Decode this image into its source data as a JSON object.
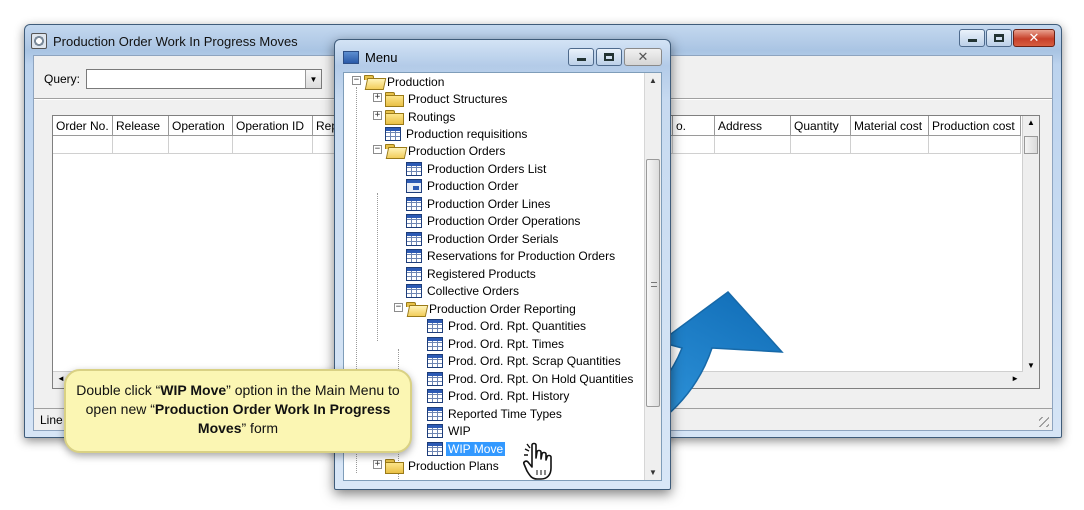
{
  "main_window": {
    "title": "Production Order Work In Progress Moves",
    "query_label": "Query:",
    "query_value": "",
    "columns": [
      "Order No.",
      "Release",
      "Operation",
      "Operation ID",
      "Rep",
      "o.",
      "Address",
      "Quantity",
      "Material cost",
      "Production cost"
    ],
    "status_text": "Line"
  },
  "menu_window": {
    "title": "Menu",
    "items": [
      {
        "label": "Production"
      },
      {
        "label": "Product Structures"
      },
      {
        "label": "Routings"
      },
      {
        "label": "Production requisitions"
      },
      {
        "label": "Production Orders"
      },
      {
        "label": "Production Orders List"
      },
      {
        "label": "Production Order"
      },
      {
        "label": "Production Order Lines"
      },
      {
        "label": "Production Order Operations"
      },
      {
        "label": "Production Order Serials"
      },
      {
        "label": "Reservations for Production Orders"
      },
      {
        "label": "Registered Products"
      },
      {
        "label": "Collective Orders"
      },
      {
        "label": "Production Order Reporting"
      },
      {
        "label": "Prod. Ord. Rpt. Quantities"
      },
      {
        "label": "Prod. Ord. Rpt. Times"
      },
      {
        "label": "Prod. Ord. Rpt. Scrap Quantities"
      },
      {
        "label": "Prod. Ord. Rpt. On Hold Quantities"
      },
      {
        "label": "Prod. Ord. Rpt. History"
      },
      {
        "label": "Reported Time Types"
      },
      {
        "label": "WIP"
      },
      {
        "label": "WIP Move"
      },
      {
        "label": "Production Plans"
      }
    ],
    "selected_item": "WIP Move"
  },
  "callout": {
    "t1": "Double click “",
    "b1": "WIP Move",
    "t2": "” option in the Main Menu to open new “",
    "b2": "Production Order Work In Progress Moves",
    "t3": "” form"
  },
  "colors": {
    "selection": "#3399ff",
    "callout_bg": "#fbf6b3",
    "arrow_blue": "#2b8fd6",
    "close_red": "#c7402a"
  },
  "icons": [
    "window-app-icon",
    "folder-icon",
    "folder-open-icon",
    "table-form-icon",
    "detail-form-icon",
    "hand-cursor-icon",
    "curved-arrow-icon"
  ]
}
